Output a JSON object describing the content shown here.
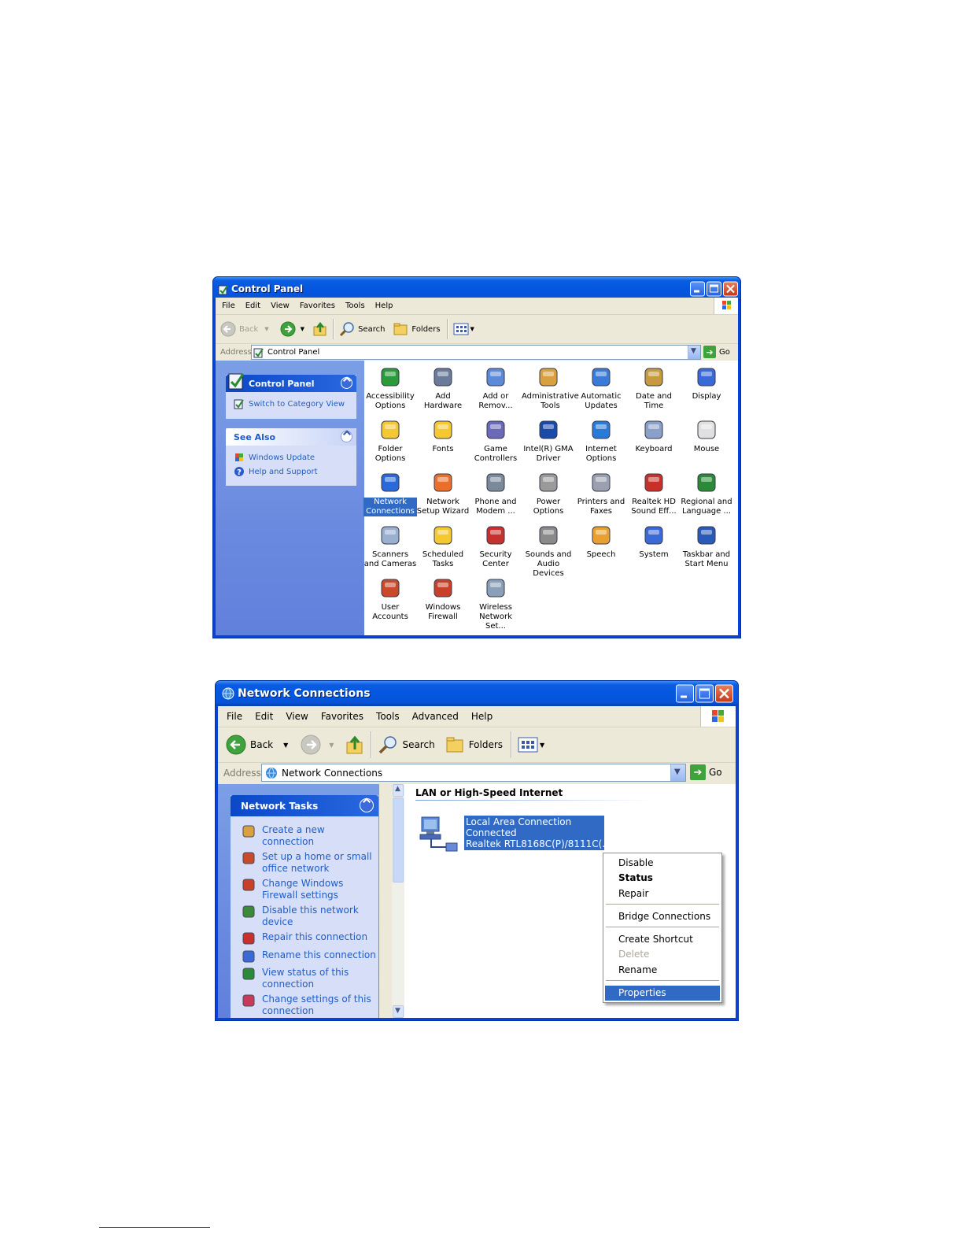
{
  "control_panel": {
    "title": "Control Panel",
    "menu": [
      "File",
      "Edit",
      "View",
      "Favorites",
      "Tools",
      "Help"
    ],
    "toolbar": {
      "back": "Back",
      "search": "Search",
      "folders": "Folders"
    },
    "address": {
      "label": "Address",
      "value": "Control Panel",
      "go": "Go"
    },
    "sidebar": {
      "panel_title": "Control Panel",
      "switch_link": "Switch to Category View",
      "see_also_title": "See Also",
      "see_also": [
        "Windows Update",
        "Help and Support"
      ]
    },
    "items": [
      {
        "label": "Accessibility Options",
        "icon": "accessibility-icon"
      },
      {
        "label": "Add Hardware",
        "icon": "add-hardware-icon"
      },
      {
        "label": "Add or Remov...",
        "icon": "add-remove-programs-icon"
      },
      {
        "label": "Administrative Tools",
        "icon": "administrative-tools-icon"
      },
      {
        "label": "Automatic Updates",
        "icon": "automatic-updates-icon"
      },
      {
        "label": "Date and Time",
        "icon": "date-time-icon"
      },
      {
        "label": "Display",
        "icon": "display-icon"
      },
      {
        "label": "Folder Options",
        "icon": "folder-options-icon"
      },
      {
        "label": "Fonts",
        "icon": "fonts-icon"
      },
      {
        "label": "Game Controllers",
        "icon": "game-controllers-icon"
      },
      {
        "label": "Intel(R) GMA Driver",
        "icon": "intel-gma-icon"
      },
      {
        "label": "Internet Options",
        "icon": "internet-options-icon"
      },
      {
        "label": "Keyboard",
        "icon": "keyboard-icon"
      },
      {
        "label": "Mouse",
        "icon": "mouse-icon"
      },
      {
        "label": "Network Connections",
        "icon": "network-connections-icon"
      },
      {
        "label": "Network Setup Wizard",
        "icon": "network-setup-icon"
      },
      {
        "label": "Phone and Modem ...",
        "icon": "phone-modem-icon"
      },
      {
        "label": "Power Options",
        "icon": "power-options-icon"
      },
      {
        "label": "Printers and Faxes",
        "icon": "printers-icon"
      },
      {
        "label": "Realtek HD Sound Eff...",
        "icon": "realtek-sound-icon"
      },
      {
        "label": "Regional and Language ...",
        "icon": "regional-language-icon"
      },
      {
        "label": "Scanners and Cameras",
        "icon": "scanners-icon"
      },
      {
        "label": "Scheduled Tasks",
        "icon": "scheduled-tasks-icon"
      },
      {
        "label": "Security Center",
        "icon": "security-center-icon"
      },
      {
        "label": "Sounds and Audio Devices",
        "icon": "sounds-icon"
      },
      {
        "label": "Speech",
        "icon": "speech-icon"
      },
      {
        "label": "System",
        "icon": "system-icon"
      },
      {
        "label": "Taskbar and Start Menu",
        "icon": "taskbar-icon"
      },
      {
        "label": "User Accounts",
        "icon": "user-accounts-icon"
      },
      {
        "label": "Windows Firewall",
        "icon": "firewall-icon"
      },
      {
        "label": "Wireless Network Set...",
        "icon": "wireless-icon"
      }
    ],
    "selected_item": "Network Connections"
  },
  "network_connections": {
    "title": "Network Connections",
    "menu": [
      "File",
      "Edit",
      "View",
      "Favorites",
      "Tools",
      "Advanced",
      "Help"
    ],
    "toolbar": {
      "back": "Back",
      "search": "Search",
      "folders": "Folders"
    },
    "address": {
      "label": "Address",
      "value": "Network Connections",
      "go": "Go"
    },
    "tasks_title": "Network Tasks",
    "tasks": [
      [
        "Create a new",
        "connection"
      ],
      [
        "Set up a home or small",
        "office network"
      ],
      [
        "Change Windows",
        "Firewall settings"
      ],
      [
        "Disable this network",
        "device"
      ],
      [
        "Repair this connection"
      ],
      [
        "Rename this connection"
      ],
      [
        "View status of this",
        "connection"
      ],
      [
        "Change settings of this",
        "connection"
      ]
    ],
    "group_header": "LAN or High-Speed Internet",
    "connection": {
      "name": "Local Area Connection",
      "status": "Connected",
      "device": "Realtek RTL8168C(P)/8111C(..."
    },
    "context_menu": [
      {
        "label": "Disable"
      },
      {
        "label": "Status",
        "style": "bold"
      },
      {
        "label": "Repair"
      },
      {
        "label": "Bridge Connections"
      },
      {
        "label": "Create Shortcut"
      },
      {
        "label": "Delete",
        "style": "disabled"
      },
      {
        "label": "Rename"
      },
      {
        "label": "Properties",
        "style": "highlighted"
      }
    ]
  },
  "colors": {
    "xp_blue": "#0842d8",
    "link": "#215dc6",
    "selection": "#316ac5",
    "task_header": "#c8d4f0"
  }
}
